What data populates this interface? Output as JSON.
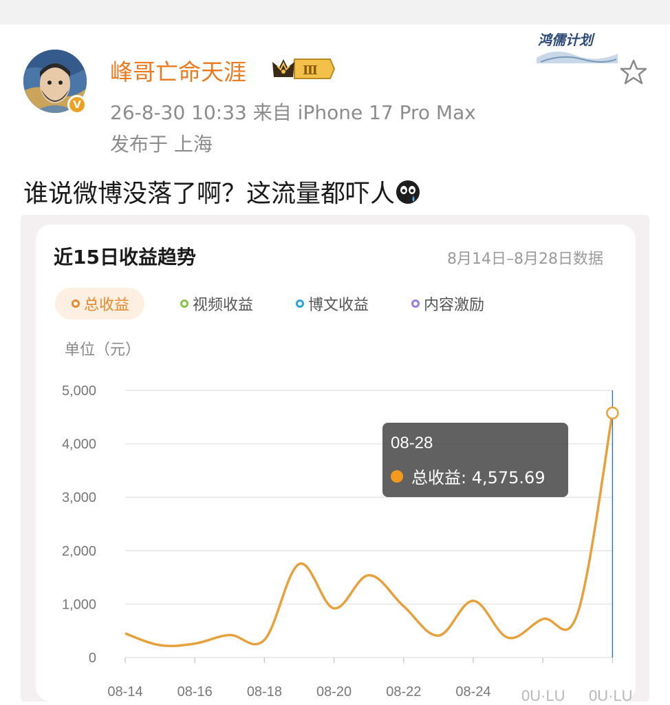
{
  "post": {
    "username": "峰哥亡命天涯",
    "level_badge": "Ⅲ",
    "verified_mark": "V",
    "time_source": "26-8-30 10:33  来自 iPhone 17 Pro Max",
    "location": "发布于 上海",
    "campaign_tag": "鸿儒计划",
    "text": "谁说微博没落了啊？这流量都吓人",
    "emoji": "crying-face-emoji",
    "favorite_icon": "star-outline-icon"
  },
  "card": {
    "title": "近15日收益趋势",
    "date_range": "8月14日–8月28日数据",
    "unit": "单位（元）",
    "legend": [
      {
        "label": "总收益",
        "color": "#e88a2b",
        "active": true
      },
      {
        "label": "视频收益",
        "color": "#8bc34a",
        "active": false
      },
      {
        "label": "博文收益",
        "color": "#29a3d8",
        "active": false
      },
      {
        "label": "内容激励",
        "color": "#9b7fe0",
        "active": false
      }
    ],
    "tooltip": {
      "date": "08-28",
      "label": "总收益: 4,575.69"
    },
    "watermark_partial": [
      "0U·LU",
      "0U·LU"
    ]
  },
  "chart_data": {
    "type": "line",
    "title": "近15日收益趋势",
    "xlabel": "",
    "ylabel": "单位（元）",
    "x": [
      "08-14",
      "08-15",
      "08-16",
      "08-17",
      "08-18",
      "08-19",
      "08-20",
      "08-21",
      "08-22",
      "08-23",
      "08-24",
      "08-25",
      "08-26",
      "08-27",
      "08-28"
    ],
    "x_tick_labels": [
      "08-14",
      "08-16",
      "08-18",
      "08-20",
      "08-22",
      "08-24"
    ],
    "y_tick_labels": [
      "0",
      "1,000",
      "2,000",
      "3,000",
      "4,000",
      "5,000"
    ],
    "ylim": [
      0,
      5000
    ],
    "series": [
      {
        "name": "总收益",
        "color": "#e8a03a",
        "values": [
          450,
          230,
          260,
          420,
          330,
          1750,
          920,
          1540,
          960,
          410,
          1060,
          370,
          720,
          830,
          4575.69
        ]
      }
    ],
    "grid": true,
    "highlight_index": 14
  }
}
